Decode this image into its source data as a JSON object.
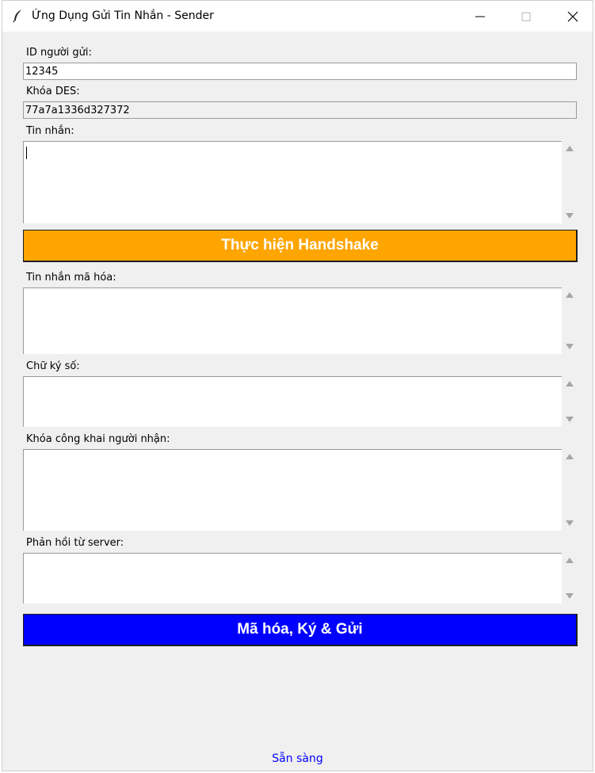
{
  "window": {
    "title": "Ứng Dụng Gửi Tin Nhắn - Sender"
  },
  "fields": {
    "sender_id": {
      "label": "ID người gửi:",
      "value": "12345"
    },
    "des_key": {
      "label": "Khóa DES:",
      "value": "77a7a1336d327372"
    },
    "message": {
      "label": "Tin nhắn:",
      "value": ""
    },
    "encrypted_message": {
      "label": "Tin nhắn mã hóa:",
      "value": ""
    },
    "signature": {
      "label": "Chữ ký số:",
      "value": ""
    },
    "receiver_public_key": {
      "label": "Khóa công khai người nhận:",
      "value": ""
    },
    "server_response": {
      "label": "Phản hồi từ server:",
      "value": ""
    }
  },
  "buttons": {
    "handshake": {
      "label": "Thực hiện Handshake",
      "color": "#ffa500"
    },
    "send": {
      "label": "Mã hóa, Ký & Gửi",
      "color": "#0000ff"
    }
  },
  "status": {
    "text": "Sẵn sàng",
    "color": "#0000ff"
  },
  "icons": {
    "app": "feather-icon",
    "minimize": "minimize-icon",
    "maximize": "maximize-icon",
    "close": "close-icon"
  }
}
